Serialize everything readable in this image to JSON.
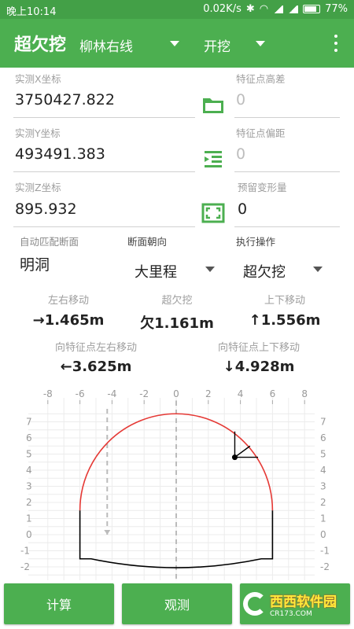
{
  "status_bar": {
    "time": "晚上10:14",
    "speed": "0.02K/s",
    "battery": "77%"
  },
  "app_bar": {
    "title": "超欠挖",
    "line_select": "柳林右线",
    "mode_select": "开挖"
  },
  "fields": {
    "x_label": "实测X坐标",
    "x_value": "3750427.822",
    "y_label": "实测Y坐标",
    "y_value": "493491.383",
    "z_label": "实测Z坐标",
    "z_value": "895.932",
    "height_diff_label": "特征点高差",
    "height_diff_value": "0",
    "offset_label": "特征点偏距",
    "offset_value": "0",
    "deform_label": "预留变形量",
    "deform_value": "0"
  },
  "section": {
    "auto_match_label": "自动匹配断面",
    "auto_match_value": "明洞",
    "direction_label": "断面朝向",
    "direction_value": "大里程",
    "action_label": "执行操作",
    "action_value": "超欠挖"
  },
  "metrics": {
    "lr_label": "左右移动",
    "lr_value": "→1.465m",
    "over_label": "超欠挖",
    "over_value": "欠1.161m",
    "ud_label": "上下移动",
    "ud_value": "↑1.556m",
    "feat_lr_label": "向特征点左右移动",
    "feat_lr_value": "←3.625m",
    "feat_ud_label": "向特征点上下移动",
    "feat_ud_value": "↓4.928m"
  },
  "colors": {
    "primary": "#4caf50",
    "status_bar": "#43a047",
    "arch": "#e53935",
    "profile": "#000000"
  },
  "chart_data": {
    "type": "scatter",
    "x_ticks": [
      "-8",
      "-6",
      "-4",
      "-2",
      "0",
      "2",
      "4",
      "6",
      "8"
    ],
    "y_ticks": [
      "7",
      "6",
      "5",
      "4",
      "3",
      "2",
      "1",
      "0",
      "-1",
      "-2"
    ],
    "xlim": [
      -8,
      8
    ],
    "ylim": [
      -2,
      7
    ],
    "arch": {
      "center": [
        0,
        1.5
      ],
      "radius": 6
    },
    "measured_point": {
      "x": 3.65,
      "y": 4.8
    },
    "grid": true
  },
  "buttons": {
    "calc": "计算",
    "observe": "观测"
  },
  "watermark": {
    "main": "西西软件园",
    "sub": "CR173.COM"
  }
}
